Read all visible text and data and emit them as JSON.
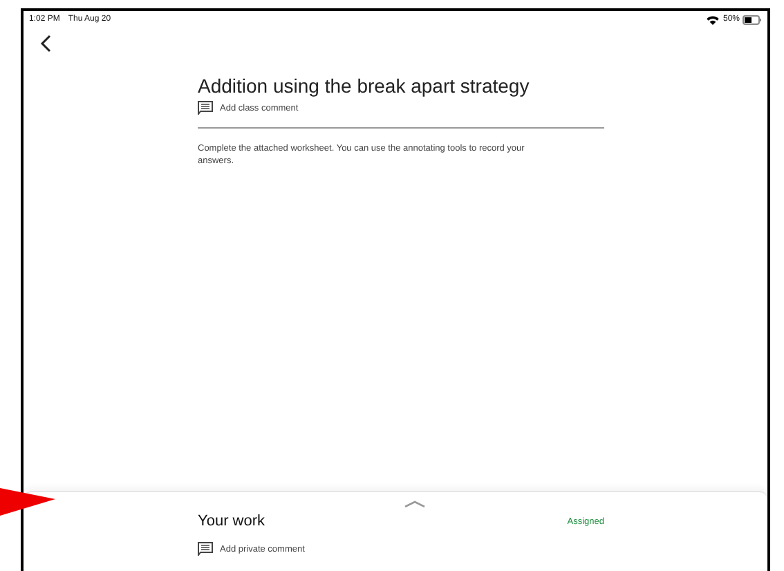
{
  "status_bar": {
    "time": "1:02 PM",
    "date": "Thu Aug 20",
    "battery": "50%"
  },
  "assignment": {
    "title": "Addition using the break apart strategy",
    "comment_link": "Add class comment",
    "instructions": "Complete the attached worksheet.  You can use the annotating tools to record your answers."
  },
  "your_work": {
    "title": "Your work",
    "status": "Assigned",
    "comment_link": "Add private comment"
  }
}
